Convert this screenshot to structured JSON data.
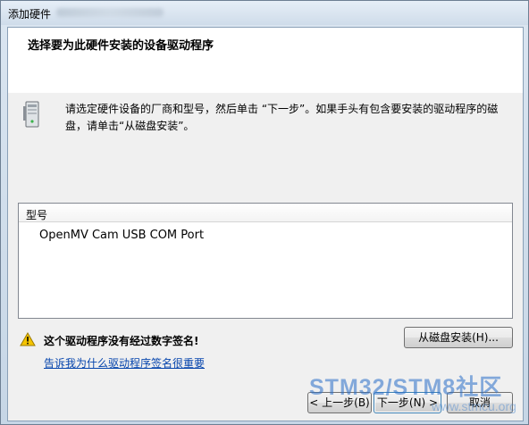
{
  "window": {
    "title": "添加硬件"
  },
  "header": {
    "title": "选择要为此硬件安装的设备驱动程序"
  },
  "instruction": "请选定硬件设备的厂商和型号，然后单击 “下一步”。如果手头有包含要安装的驱动程序的磁盘，请单击“从磁盘安装”。",
  "model_list": {
    "column_header": "型号",
    "items": [
      "OpenMV Cam USB COM Port"
    ]
  },
  "warning": {
    "text": "这个驱动程序没有经过数字签名!",
    "icon": "warning-icon",
    "link": "告诉我为什么驱动程序签名很重要"
  },
  "buttons": {
    "have_disk": "从磁盘安装(H)...",
    "back": "< 上一步(B)",
    "next": "下一步(N) >",
    "cancel": "取消"
  },
  "watermark": {
    "line1": "STM32/STM8社区",
    "line2": "www.stmcu.org"
  },
  "icons": {
    "hardware": "hardware-tower-icon"
  },
  "colors": {
    "link": "#0645ad",
    "warning": "#f5c400",
    "header_bg": "#ffffff"
  }
}
